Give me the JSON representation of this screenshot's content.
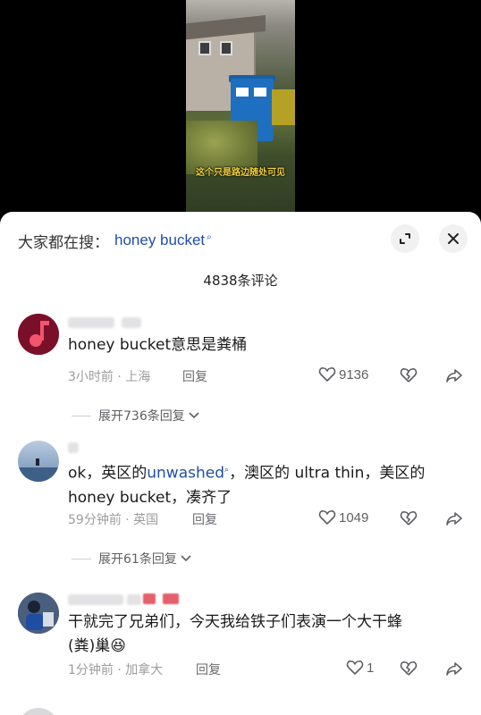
{
  "video": {
    "caption": "这个只是路边随处可见"
  },
  "search": {
    "prefix": "大家都在搜：",
    "term": "honey bucket"
  },
  "comments_header": {
    "count_label": "4838条评论"
  },
  "comments": [
    {
      "text": "honey bucket意思是粪桶",
      "time_location": "3小时前 · 上海",
      "reply_label": "回复",
      "likes": "9136",
      "replies_label": "展开736条回复"
    },
    {
      "text_line1_a": "ok，英区的",
      "text_line1_highlight": "unwashed",
      "text_line1_b": "，澳区的 ultra thin，美区的",
      "text_line2": "honey bucket，凑齐了",
      "time_location": "59分钟前 · 英国",
      "reply_label": "回复",
      "likes": "1049",
      "replies_label": "展开61条回复"
    },
    {
      "text_line1": "干就完了兄弟们，今天我给铁子们表演一个大干蜂",
      "text_line2": "(粪)巢",
      "emoji": "😆",
      "time_location": "1分钟前 · 加拿大",
      "reply_label": "回复",
      "likes": "1"
    }
  ],
  "colors": {
    "link": "#1f4fa8",
    "meta": "#9c9c9f",
    "sheet_bg": "#ffffff"
  }
}
